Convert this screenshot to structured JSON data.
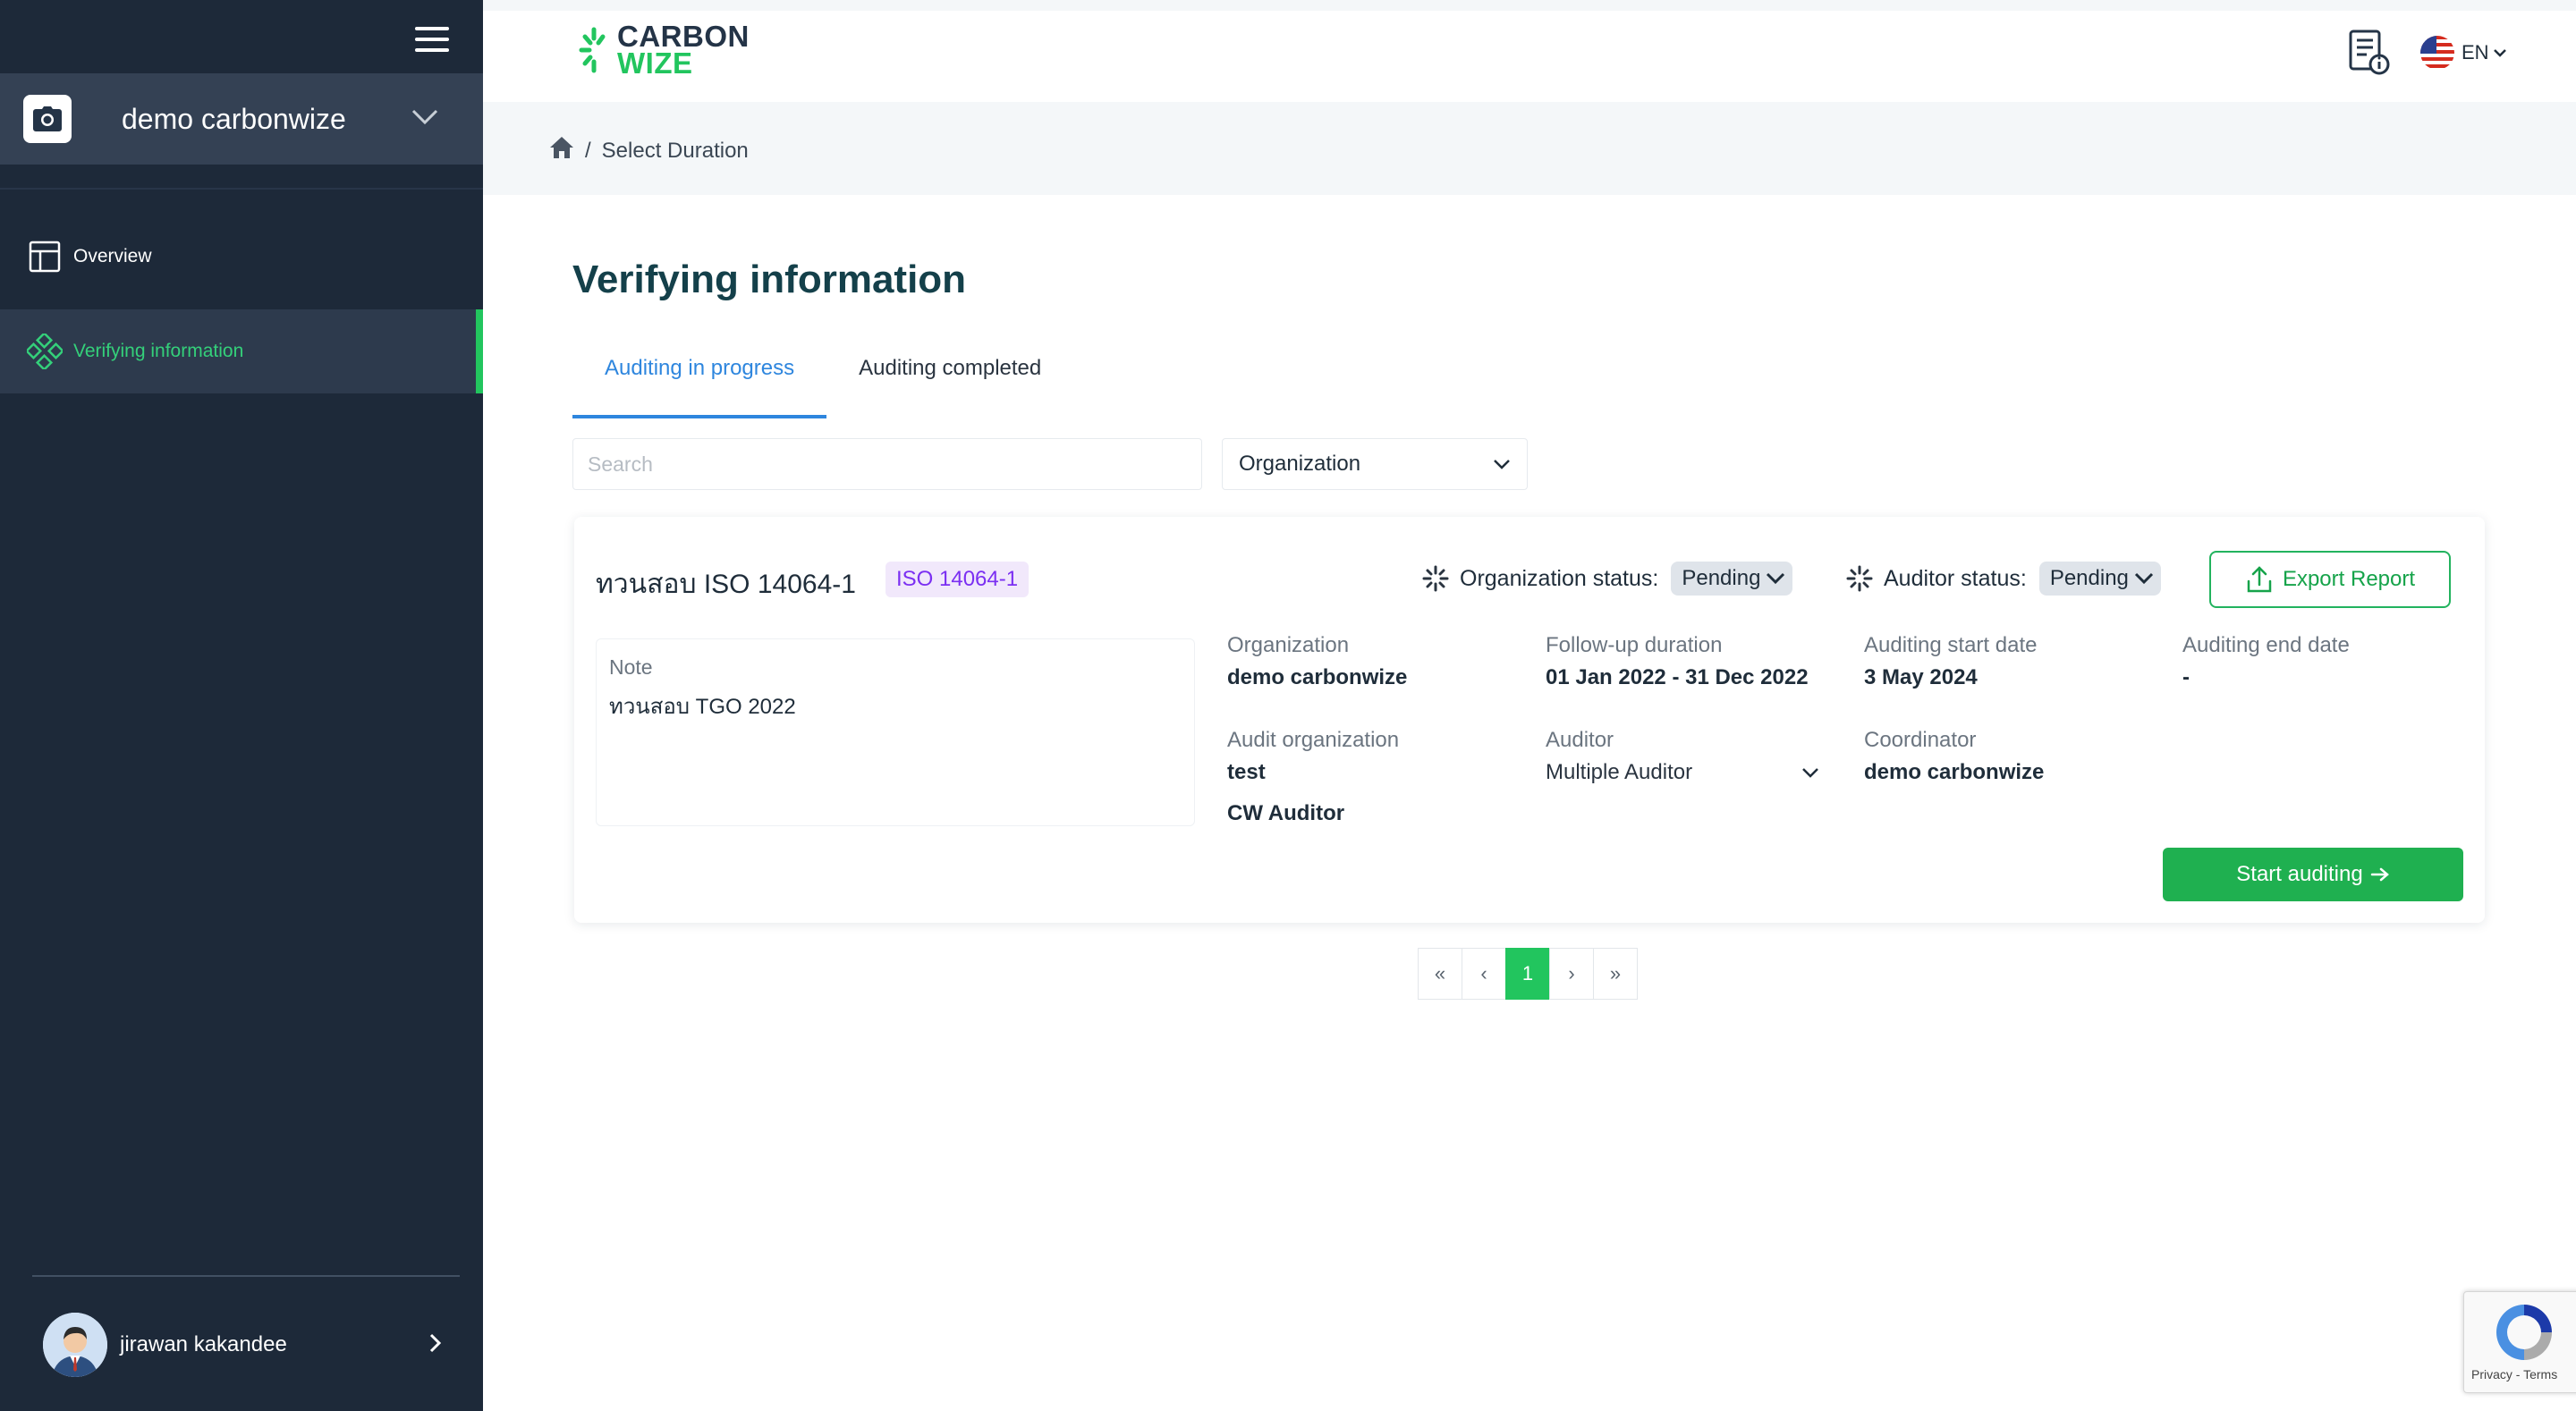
{
  "sidebar": {
    "org_name": "demo carbonwize",
    "items": [
      {
        "label": "Overview"
      },
      {
        "label": "Verifying information"
      }
    ],
    "user_name": "jirawan kakandee"
  },
  "header": {
    "logo_line1": "CARBON",
    "logo_line2": "WIZE",
    "language": "EN"
  },
  "breadcrumb": {
    "current": "Select Duration",
    "separator": "/"
  },
  "page": {
    "title": "Verifying information",
    "tabs": [
      {
        "label": "Auditing in progress"
      },
      {
        "label": "Auditing completed"
      }
    ],
    "search_placeholder": "Search",
    "org_filter": "Organization"
  },
  "card": {
    "title": "ทวนสอบ ISO 14064-1",
    "badge": "ISO 14064-1",
    "org_status_label": "Organization status:",
    "org_status_value": "Pending",
    "auditor_status_label": "Auditor status:",
    "auditor_status_value": "Pending",
    "export_label": "Export Report",
    "note_label": "Note",
    "note_text": "ทวนสอบ TGO 2022",
    "organization_label": "Organization",
    "organization_value": "demo carbonwize",
    "followup_label": "Follow-up duration",
    "followup_value": "01 Jan 2022 - 31 Dec 2022",
    "start_date_label": "Auditing start date",
    "start_date_value": "3 May 2024",
    "end_date_label": "Auditing end date",
    "end_date_value": "-",
    "audit_org_label": "Audit organization",
    "audit_org_value": "test",
    "audit_org_value2": "CW Auditor",
    "auditor_label": "Auditor",
    "auditor_value": "Multiple Auditor",
    "coordinator_label": "Coordinator",
    "coordinator_value": "demo carbonwize",
    "start_button": "Start auditing"
  },
  "pagination": {
    "first": "«",
    "prev": "‹",
    "current": "1",
    "next": "›",
    "last": "»"
  },
  "recaptcha": {
    "text": "Privacy - Terms"
  },
  "colors": {
    "sidebar_bg": "#1d2939",
    "accent_green": "#22c55e",
    "tab_blue": "#2e86de",
    "title_teal": "#14404a",
    "badge_purple": "#7b2ff2"
  }
}
